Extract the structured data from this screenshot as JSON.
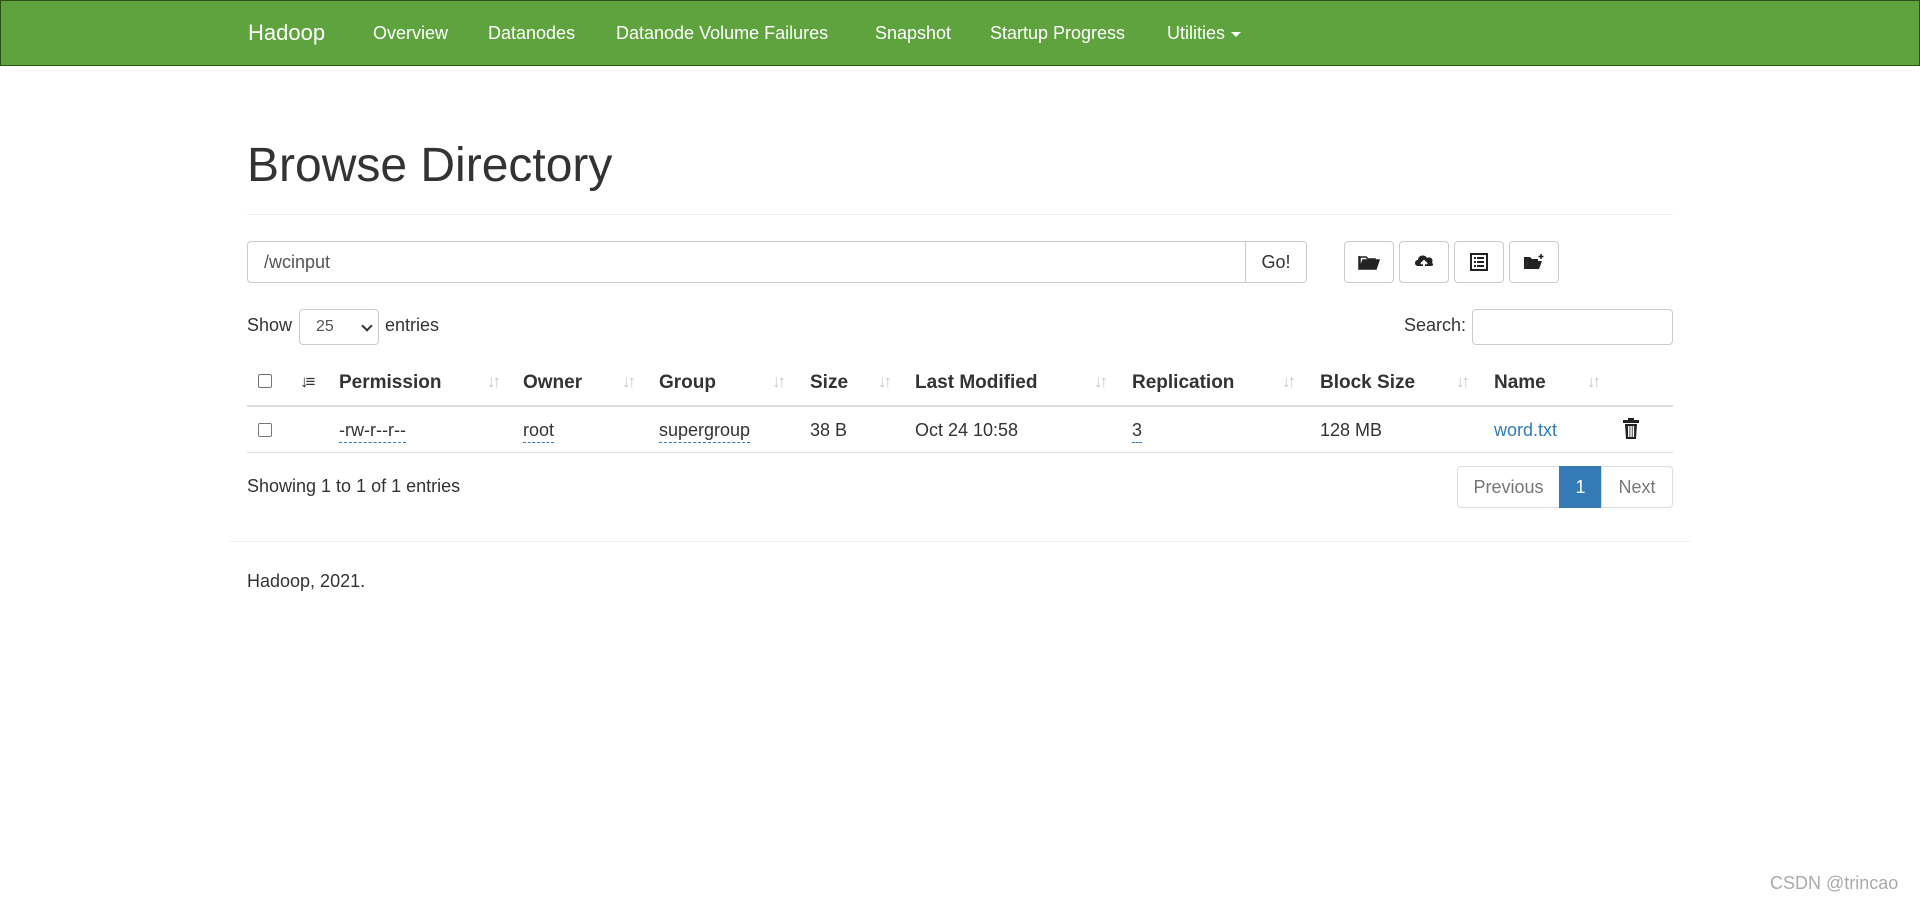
{
  "navbar": {
    "brand": "Hadoop",
    "items": [
      "Overview",
      "Datanodes",
      "Datanode Volume Failures",
      "Snapshot",
      "Startup Progress",
      "Utilities"
    ],
    "background": "#5fa33e"
  },
  "page": {
    "title": "Browse Directory"
  },
  "path_bar": {
    "value": "/wcinput",
    "go_label": "Go!",
    "action_icons": [
      "folder-open-icon",
      "cloud-upload-icon",
      "list-alt-icon",
      "folder-plus-icon"
    ]
  },
  "table_controls": {
    "show_label": "Show",
    "entries_value": "25",
    "entries_label": "entries",
    "search_label": "Search:",
    "search_value": ""
  },
  "table": {
    "columns": [
      "Permission",
      "Owner",
      "Group",
      "Size",
      "Last Modified",
      "Replication",
      "Block Size",
      "Name"
    ],
    "rows": [
      {
        "permission": "-rw-r--r--",
        "owner": "root",
        "group": "supergroup",
        "size": "38 B",
        "last_modified": "Oct 24 10:58",
        "replication": "3",
        "block_size": "128 MB",
        "name": "word.txt"
      }
    ]
  },
  "info": "Showing 1 to 1 of 1 entries",
  "pagination": {
    "previous": "Previous",
    "current": "1",
    "next": "Next"
  },
  "footer": "Hadoop, 2021.",
  "watermark": "CSDN @trincao",
  "colors": {
    "navbar": "#5fa33e",
    "link": "#337ab7",
    "active_page": "#337ab7"
  }
}
